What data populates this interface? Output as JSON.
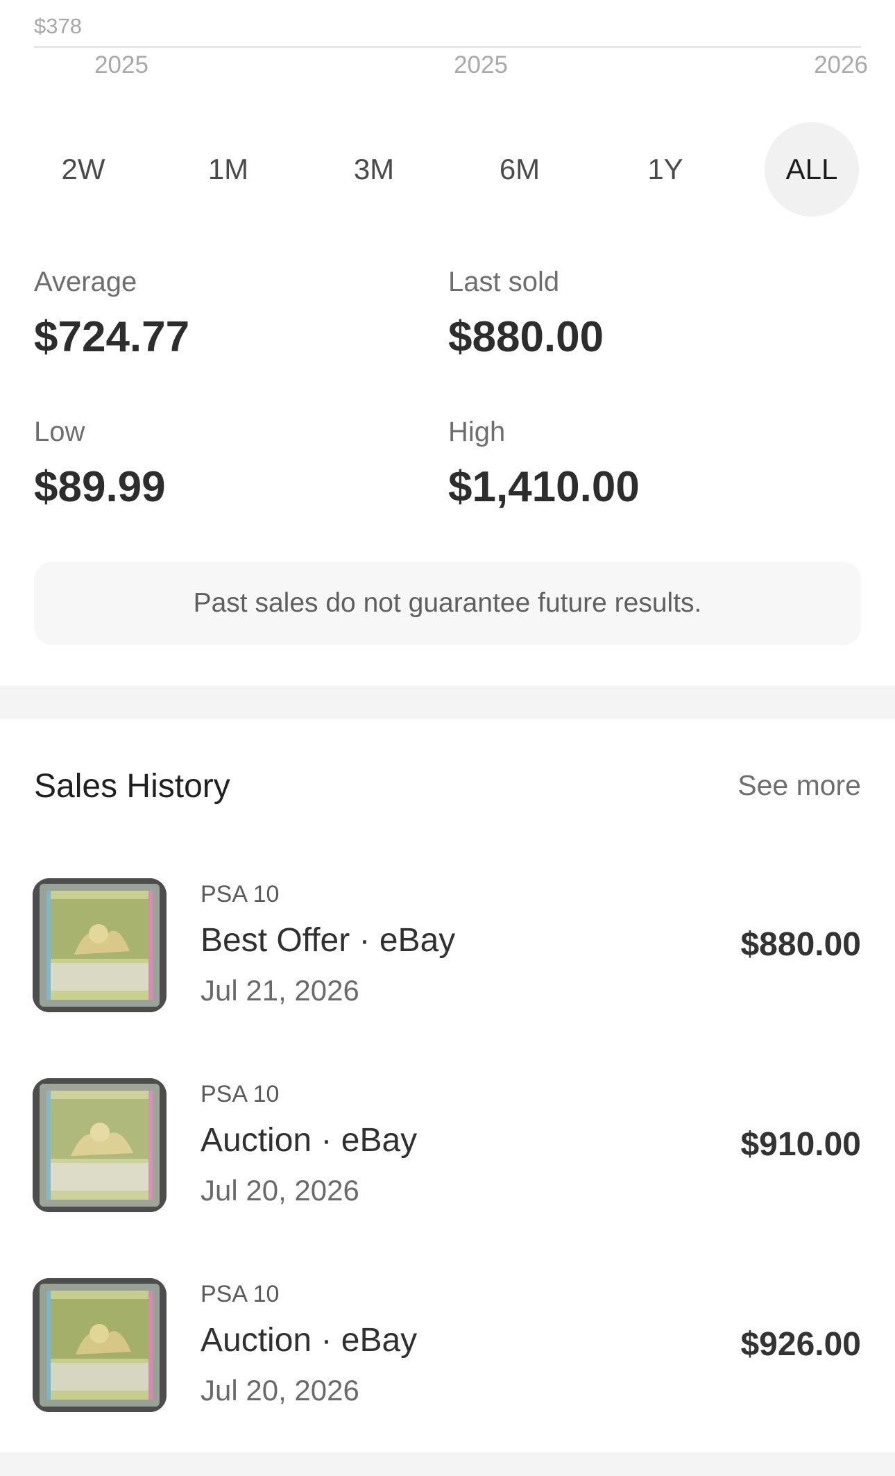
{
  "chart_axis": {
    "y_label": "$378",
    "x_ticks": [
      "2025",
      "2025",
      "2026"
    ]
  },
  "ranges": {
    "options": [
      "2W",
      "1M",
      "3M",
      "6M",
      "1Y",
      "ALL"
    ],
    "selected": "ALL"
  },
  "stats": {
    "average": {
      "label": "Average",
      "value": "$724.77"
    },
    "last_sold": {
      "label": "Last sold",
      "value": "$880.00"
    },
    "low": {
      "label": "Low",
      "value": "$89.99"
    },
    "high": {
      "label": "High",
      "value": "$1,410.00"
    }
  },
  "disclaimer": "Past sales do not guarantee future results.",
  "sales_history": {
    "title": "Sales History",
    "see_more": "See more",
    "items": [
      {
        "grade": "PSA 10",
        "type": "Best Offer · eBay",
        "date": "Jul 21, 2026",
        "price": "$880.00"
      },
      {
        "grade": "PSA 10",
        "type": "Auction · eBay",
        "date": "Jul 20, 2026",
        "price": "$910.00"
      },
      {
        "grade": "PSA 10",
        "type": "Auction · eBay",
        "date": "Jul 20, 2026",
        "price": "$926.00"
      }
    ]
  },
  "colors": {
    "accent_bg": "#f1f1f1",
    "text_primary": "#2b2b2b",
    "text_secondary": "#6e6e6e"
  }
}
